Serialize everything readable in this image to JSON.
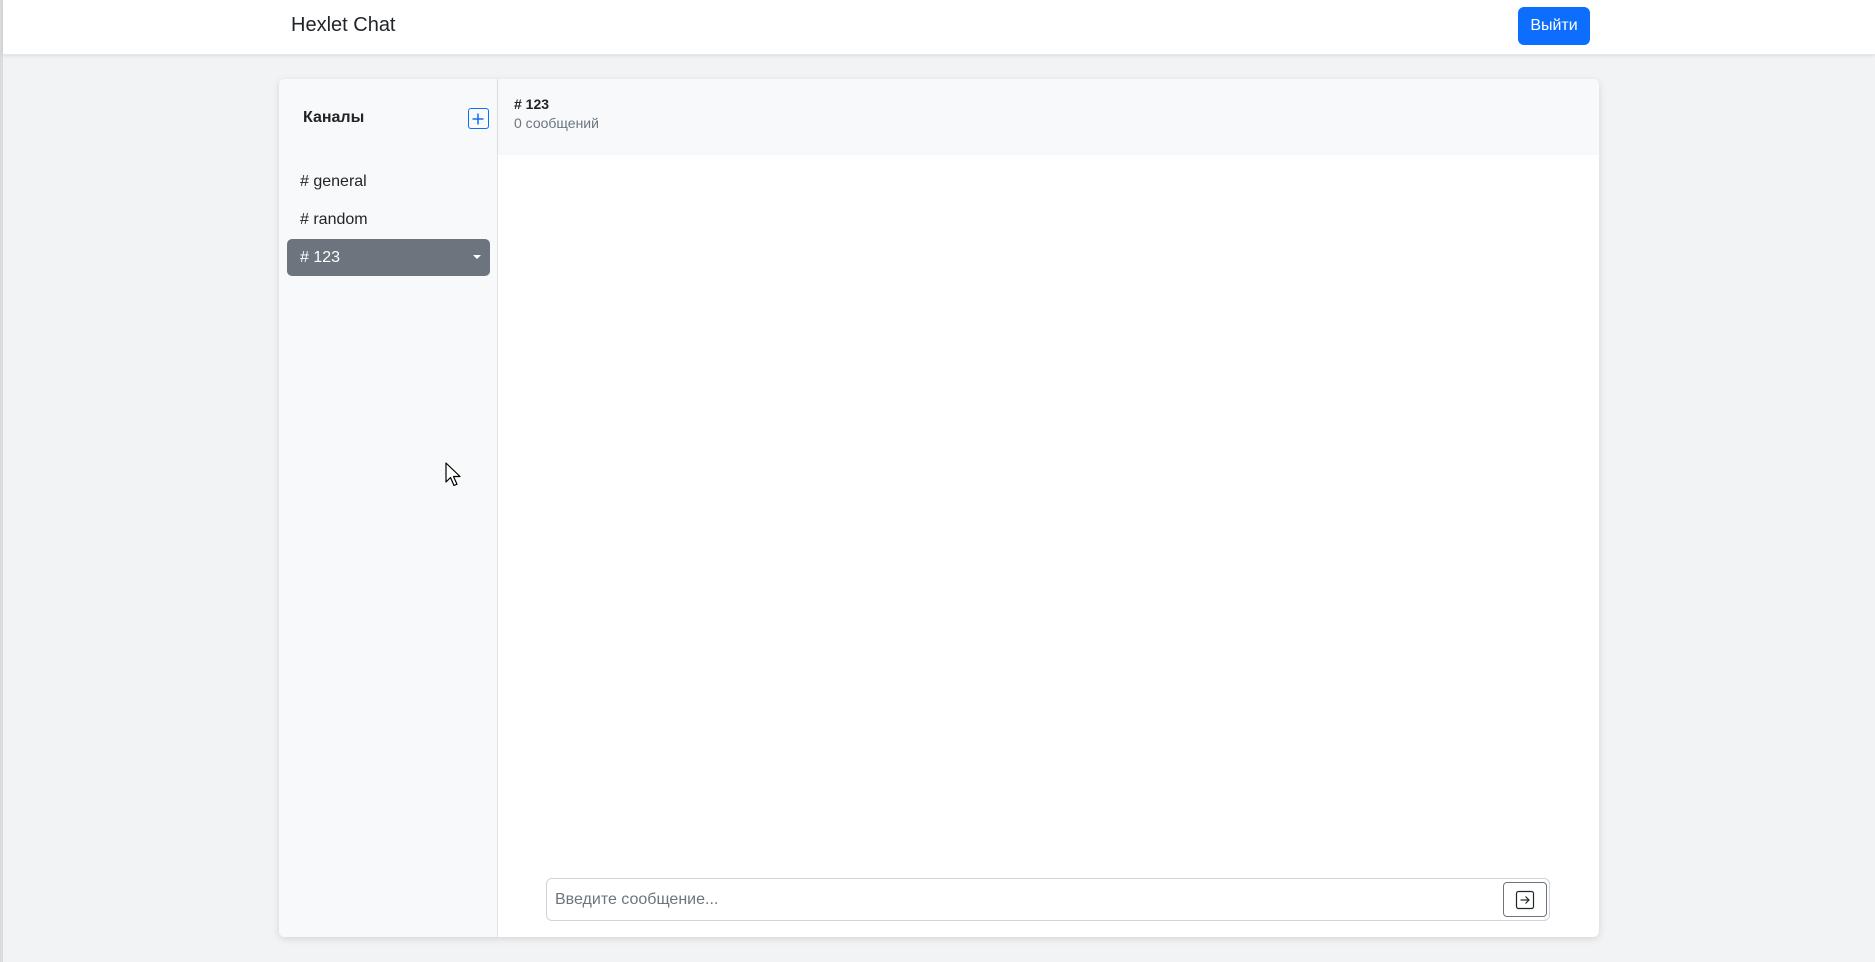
{
  "navbar": {
    "brand": "Hexlet Chat",
    "logout_label": "Выйти"
  },
  "sidebar": {
    "title": "Каналы",
    "add_icon": "plus-square-icon",
    "channels": [
      {
        "label": "# general",
        "active": false
      },
      {
        "label": "# random",
        "active": false
      },
      {
        "label": "# 123",
        "active": true
      }
    ]
  },
  "chat": {
    "channel_title": "# 123",
    "message_count": "0 сообщений",
    "input_placeholder": "Введите сообщение...",
    "send_icon": "arrow-right-square-icon"
  },
  "colors": {
    "primary": "#0d6efd",
    "active_channel": "#6c757d",
    "background": "#f2f3f5",
    "sidebar_bg": "#f8f9fa"
  }
}
